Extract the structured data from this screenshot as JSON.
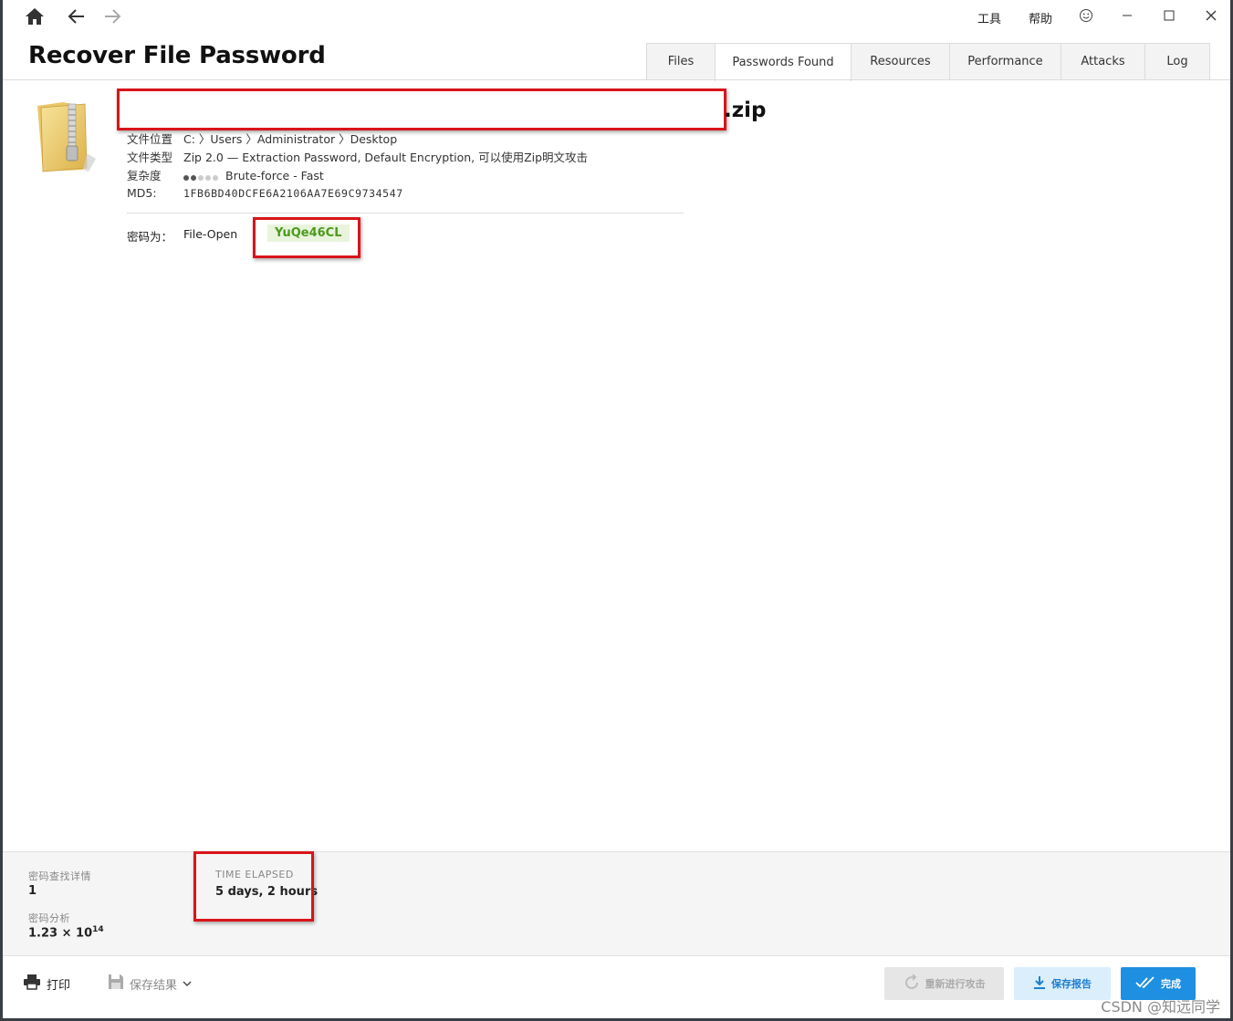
{
  "titlebar": {
    "menu_tools": "工具",
    "menu_help": "帮助"
  },
  "header": {
    "title": "Recover File Password",
    "tabs": [
      {
        "label": "Files"
      },
      {
        "label": "Passwords Found"
      },
      {
        "label": "Resources"
      },
      {
        "label": "Performance"
      },
      {
        "label": "Attacks"
      },
      {
        "label": "Log"
      }
    ],
    "active_tab": "Passwords Found"
  },
  "file": {
    "name_ext": ".zip",
    "location_label": "文件位置",
    "location_value": "C: 〉Users 〉Administrator 〉Desktop",
    "type_label": "文件类型",
    "type_value": "Zip 2.0 — Extraction Password, Default Encryption, 可以使用Zip明文攻击",
    "complexity_label": "复杂度",
    "complexity_level": 0.4,
    "complexity_value": "Brute-force - Fast",
    "md5_label": "MD5:",
    "md5_value": "1FB6BD40DCFE6A2106AA7E69C9734547"
  },
  "password": {
    "label": "密码为：",
    "type": "File-Open",
    "value": "YuQe46CL"
  },
  "stats": {
    "found_label": "密码查找详情",
    "found_value": "1",
    "analyzed_label": "密码分析",
    "analyzed_base": "1.23 × 10",
    "analyzed_exp": "14",
    "elapsed_label": "TIME ELAPSED",
    "elapsed_value": "5 days, 2 hours"
  },
  "footer": {
    "print_label": "打印",
    "save_results_label": "保存结果",
    "rerun_label": "重新进行攻击",
    "save_report_label": "保存报告",
    "done_label": "完成"
  },
  "colors": {
    "accent": "#1e8fe1",
    "password_green": "#4d9a1d",
    "password_bg": "#e8f4dc",
    "highlight_red": "#d9141b"
  },
  "watermark": "CSDN @知远同学"
}
